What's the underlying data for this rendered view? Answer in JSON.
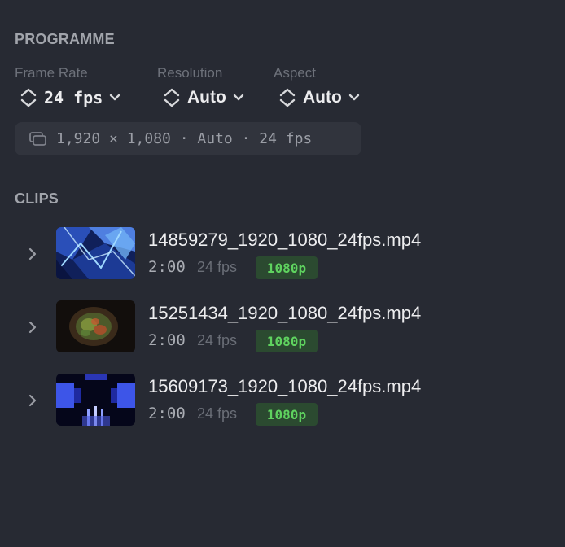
{
  "programme": {
    "title": "PROGRAMME",
    "frame_rate": {
      "label": "Frame Rate",
      "value": "24 fps"
    },
    "resolution": {
      "label": "Resolution",
      "value": "Auto"
    },
    "aspect": {
      "label": "Aspect",
      "value": "Auto"
    },
    "summary": "1,920 × 1,080 · Auto · 24 fps"
  },
  "clips": {
    "title": "CLIPS",
    "items": [
      {
        "name": "14859279_1920_1080_24fps.mp4",
        "duration": "2:00",
        "fps": "24 fps",
        "badge": "1080p"
      },
      {
        "name": "15251434_1920_1080_24fps.mp4",
        "duration": "2:00",
        "fps": "24 fps",
        "badge": "1080p"
      },
      {
        "name": "15609173_1920_1080_24fps.mp4",
        "duration": "2:00",
        "fps": "24 fps",
        "badge": "1080p"
      }
    ]
  },
  "colors": {
    "background": "#272a33",
    "badge_bg": "#2b4a30",
    "badge_text": "#5fd35f"
  }
}
